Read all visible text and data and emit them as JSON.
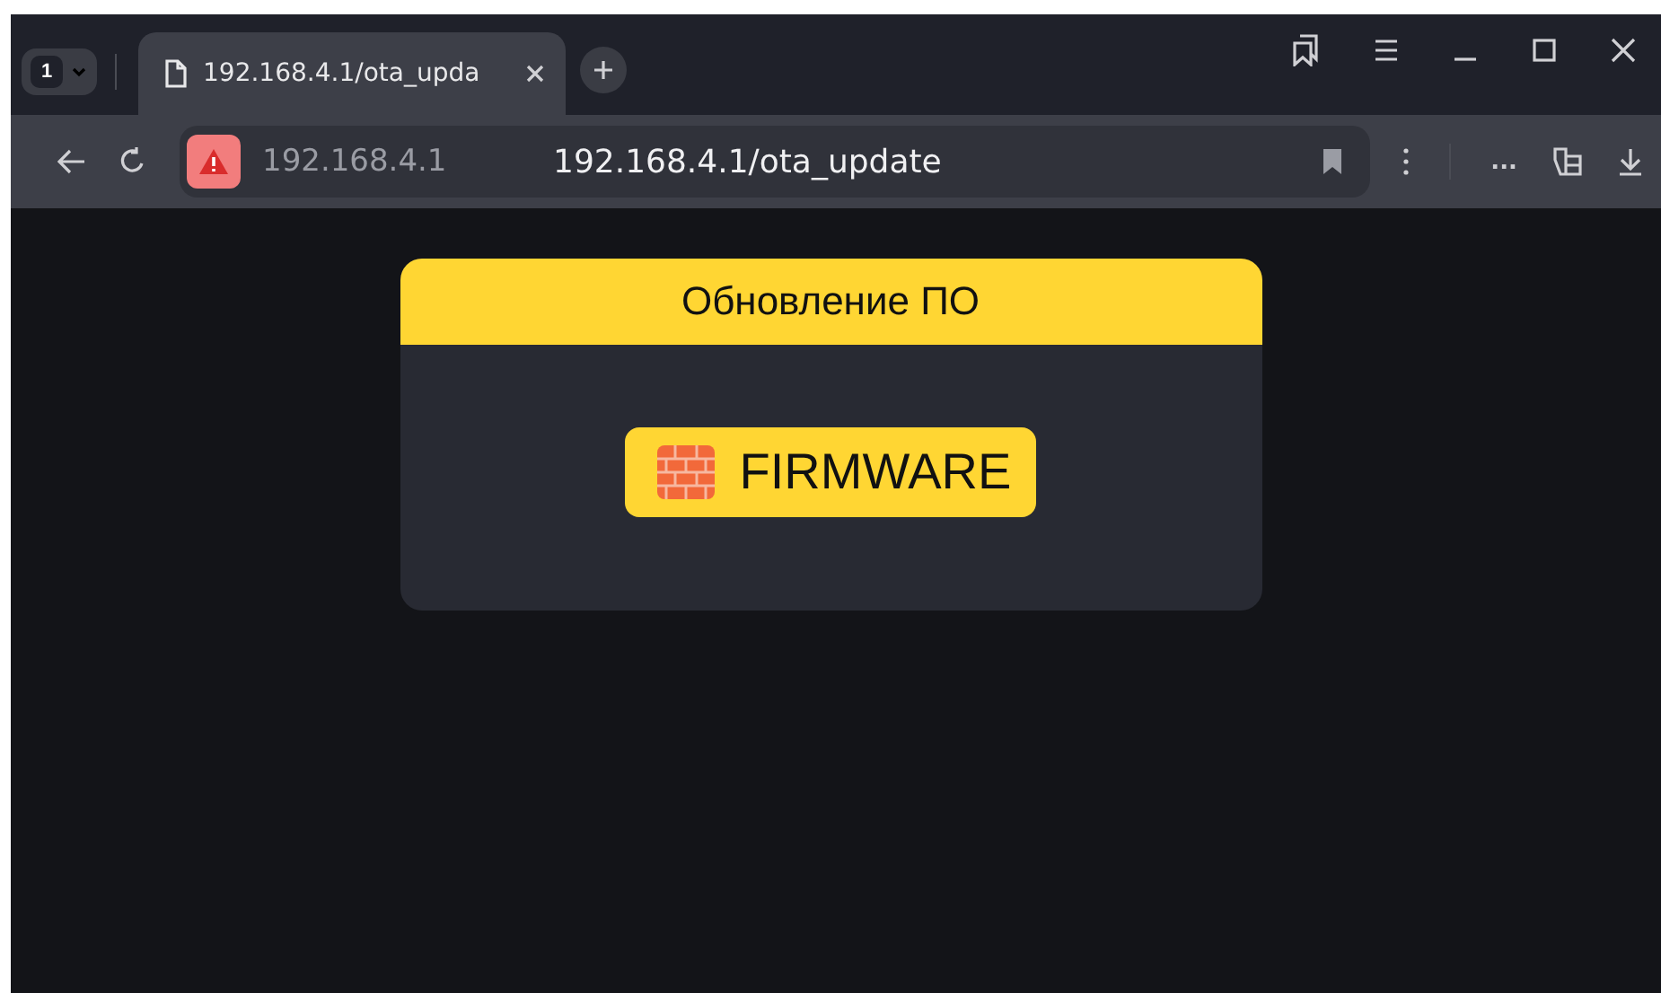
{
  "browser": {
    "tab_count": "1",
    "tabs": [
      {
        "title": "192.168.4.1/ota_upda",
        "selected": true
      }
    ],
    "address_bar": {
      "host": "192.168.4.1",
      "url": "192.168.4.1/ota_update"
    },
    "overflow": "..."
  },
  "card": {
    "title": "Обновление ПО",
    "button": {
      "label": "FIRMWARE"
    }
  }
}
